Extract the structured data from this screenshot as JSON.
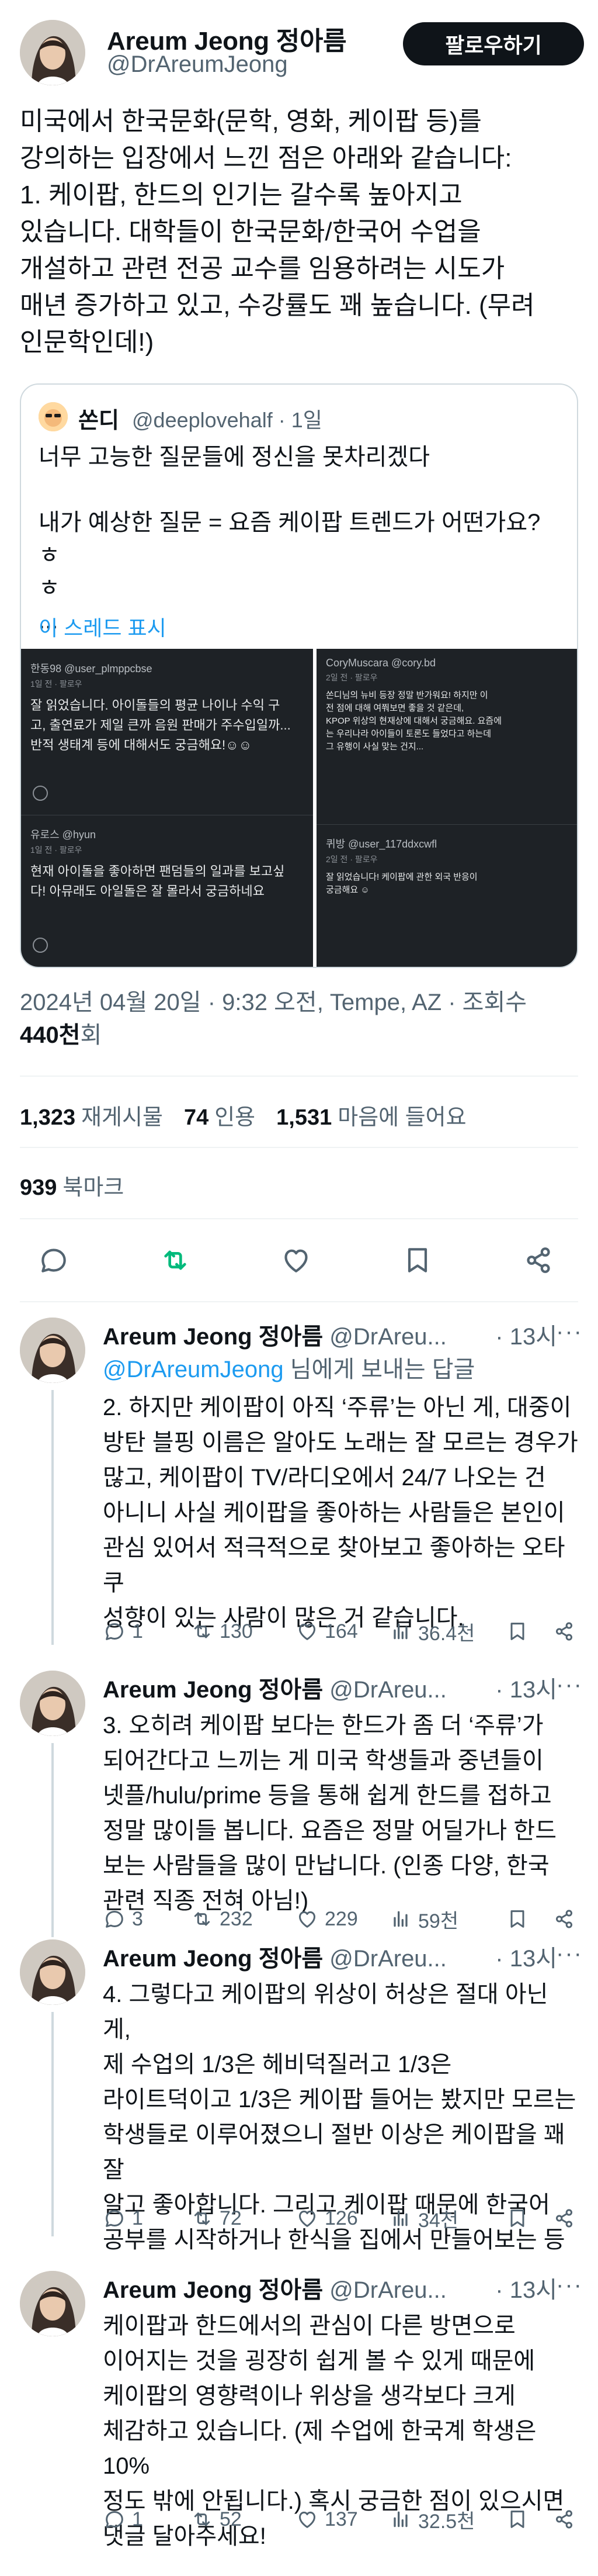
{
  "main": {
    "name": "Areum Jeong 정아름",
    "handle": "@DrAreumJeong",
    "follow_label": "팔로우하기",
    "text": "미국에서 한국문화(문학, 영화, 케이팝 등)를\n강의하는 입장에서 느낀 점은 아래와 같습니다:\n1. 케이팝, 한드의 인기는 갈수록 높아지고\n있습니다. 대학들이 한국문화/한국어 수업을\n개설하고 관련 전공 교수를 임용하려는 시도가\n매년 증가하고 있고, 수강률도 꽤 높습니다. (무려\n인문학인데!)",
    "timestamp": "2024년 04월 20일 · 9:32 오전, Tempe, AZ · 조회수",
    "views_count": "440천",
    "views_suffix": "회",
    "stats": {
      "retweets": "1,323",
      "retweets_label": "재게시물",
      "quotes": "74",
      "quotes_label": "인용",
      "likes": "1,531",
      "likes_label": "마음에 들어요",
      "bookmarks": "939",
      "bookmarks_label": "북마크"
    }
  },
  "quote": {
    "name": "쏜디",
    "handle": "@deeplovehalf · 1일",
    "text": "너무 고능한 질문들에 정신을 못차리겠다\n\n내가 예상한 질문 = 요즘 케이팝 트렌드가 어떤가요? ㅎ\nㅎ\n...",
    "show_thread": "이 스레드 표시",
    "screens": {
      "left": [
        {
          "user": "한동98 @user_plmppcbse",
          "meta": "1일 전 · 팔로우",
          "body": "잘 읽었습니다. 아이돌들의 평균 나이나 수익 구\n고, 출연료가 제일 큰까 음원 판매가 주수입일까...\n반적 생태계 등에 대해서도 궁금해요!☺☺"
        },
        {
          "user": "유로스 @hyun",
          "meta": "1일 전 · 팔로우",
          "body": "현재 아이돌을 좋아하면 팬덤들의 일과를 보고싶\n다! 아뮤래도 아일돌은 잘 몰라서 궁금하네요"
        }
      ],
      "right": [
        {
          "user": "CoryMuscara @cory.bd",
          "meta": "2일 전 · 팔로우",
          "body": "쏜디님의 뉴비 등장 정말 반가워요! 하지만 이\n전 점에 대해 여쭤보면 좋을 것 같은데,\nKPOP 위상의 현재상에 대해서 궁금해요. 요즘에\n는 우리나라 아이들이 토론도 들었다고 하는데\n그 유행이 사실 맞는 건지..."
        },
        {
          "user": "퀴방 @user_117ddxcwfl",
          "meta": "2일 전 · 팔로우",
          "body": "잘 읽었습니다! 케이팝에 관한 외국 반응이\n궁금해요 ☺"
        }
      ]
    }
  },
  "replies": [
    {
      "name": "Areum Jeong 정아름",
      "handle": "@DrAreu...",
      "time": "· 13시",
      "reply_to_prefix": "",
      "reply_to_mention": "@DrAreumJeong",
      "reply_to_suffix": " 님에게 보내는 답글",
      "text": "2. 하지만 케이팝이 아직 ‘주류’는 아닌 게, 대중이\n방탄 블핑 이름은 알아도 노래는 잘 모르는 경우가\n많고, 케이팝이 TV/라디오에서 24/7 나오는 건\n아니니 사실 케이팝을 좋아하는 사람들은 본인이\n관심 있어서 적극적으로 찾아보고 좋아하는 오타쿠\n성향이 있는 사람이 많은 거 같습니다.",
      "replies": "1",
      "retweets": "130",
      "likes": "164",
      "views": "36.4천"
    },
    {
      "name": "Areum Jeong 정아름",
      "handle": "@DrAreu...",
      "time": "· 13시",
      "text": "3. 오히려 케이팝 보다는 한드가 좀 더 ‘주류’가\n되어간다고 느끼는 게 미국 학생들과 중년들이\n넷플/hulu/prime 등을 통해 쉽게 한드를 접하고\n정말 많이들 봅니다. 요즘은 정말 어딜가나 한드\n보는 사람들을 많이 만납니다. (인종 다양, 한국\n관련 직종 전혀 아님!)",
      "replies": "3",
      "retweets": "232",
      "likes": "229",
      "views": "59천"
    },
    {
      "name": "Areum Jeong 정아름",
      "handle": "@DrAreu...",
      "time": "· 13시",
      "text": "4. 그렇다고 케이팝의 위상이 허상은 절대 아닌 게,\n제 수업의 1/3은 헤비덕질러고 1/3은\n라이트덕이고 1/3은 케이팝 들어는 봤지만 모르는\n학생들로 이루어졌으니 절반 이상은 케이팝을 꽤 잘\n알고 좋아합니다. 그리고 케이팝 때문에 한국어\n공부를 시작하거나 한식을 집에서 만들어보는 등",
      "replies": "1",
      "retweets": "72",
      "likes": "126",
      "views": "34천"
    },
    {
      "name": "Areum Jeong 정아름",
      "handle": "@DrAreu...",
      "time": "· 13시",
      "text": "케이팝과 한드에서의 관심이 다른 방면으로\n이어지는 것을 굉장히 쉽게 볼 수 있게 때문에\n케이팝의 영향력이나 위상을 생각보다 크게\n체감하고 있습니다. (제 수업에 한국계 학생은 10%\n정도 밖에 안됩니다.) 혹시 궁금한 점이 있으시면\n댓글 달아주세요!",
      "replies": "1",
      "retweets": "52",
      "likes": "137",
      "views": "32.5천"
    }
  ],
  "colors": {
    "accent": "#1d9bf0",
    "retweet_green": "#00ba7c",
    "text": "#0f1419",
    "muted": "#536471"
  },
  "icons": {
    "reply": "speech-bubble-icon",
    "retweet": "retweet-arrows-icon",
    "like": "heart-icon",
    "bookmark": "bookmark-icon",
    "share": "share-icon",
    "views": "bar-chart-icon",
    "more": "ellipsis-icon"
  }
}
